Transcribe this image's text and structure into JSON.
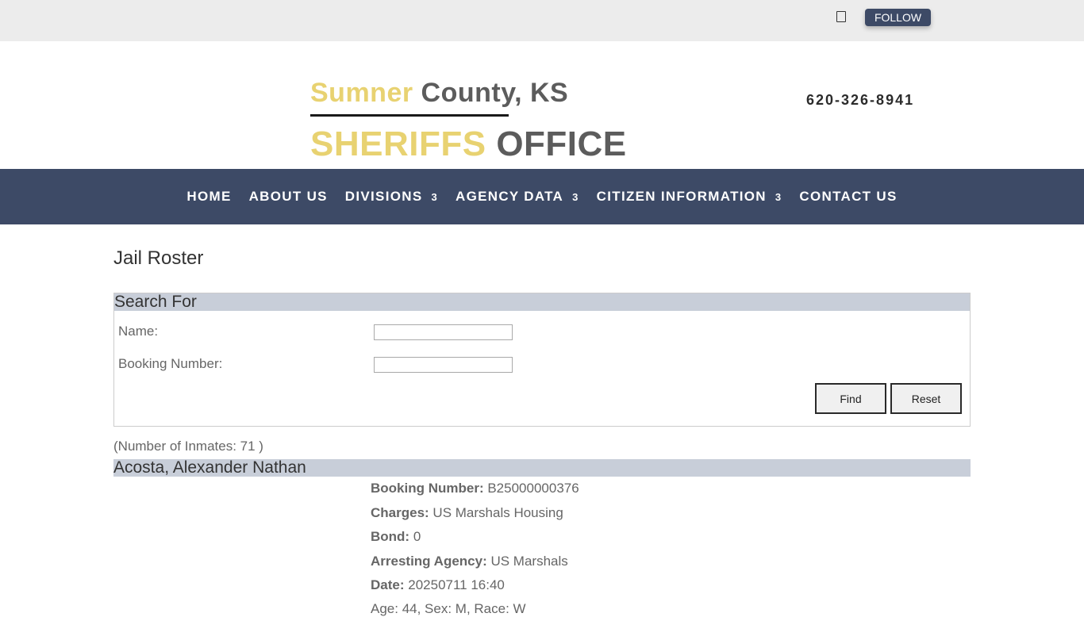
{
  "topbar": {
    "social_icon": "square-icon",
    "follow_label": "FOLLOW"
  },
  "header": {
    "logo_gold_1": "Sumner",
    "logo_gray_1": "County, KS",
    "logo_gold_2": "SHERIFFS",
    "logo_gray_2": "OFFICE",
    "phone": "620-326-8941"
  },
  "nav": {
    "items": [
      {
        "label": "HOME"
      },
      {
        "label": "ABOUT US"
      },
      {
        "label": "DIVISIONS",
        "caret": "3"
      },
      {
        "label": "AGENCY DATA",
        "caret": "3"
      },
      {
        "label": "CITIZEN INFORMATION",
        "caret": "3"
      },
      {
        "label": "CONTACT US"
      }
    ]
  },
  "main": {
    "title": "Jail Roster",
    "search": {
      "heading": "Search For",
      "name_label": "Name:",
      "name_value": "",
      "booking_label": "Booking Number:",
      "booking_value": "",
      "find_label": "Find",
      "reset_label": "Reset"
    },
    "count_text": "(Number of Inmates: 71 )",
    "inmate": {
      "name": "Acosta, Alexander Nathan",
      "booking_label": "Booking Number:",
      "booking_value": "B25000000376",
      "charges_label": "Charges:",
      "charges_value": "US Marshals Housing",
      "bond_label": "Bond:",
      "bond_value": "0",
      "agency_label": "Arresting Agency:",
      "agency_value": "US Marshals",
      "date_label": "Date:",
      "date_value": "20250711 16:40",
      "demographics": "Age: 44, Sex: M, Race: W"
    }
  },
  "colors": {
    "nav_bg": "#3d4a66",
    "gold": "#e8d271",
    "section_bg": "#c8ced9"
  }
}
